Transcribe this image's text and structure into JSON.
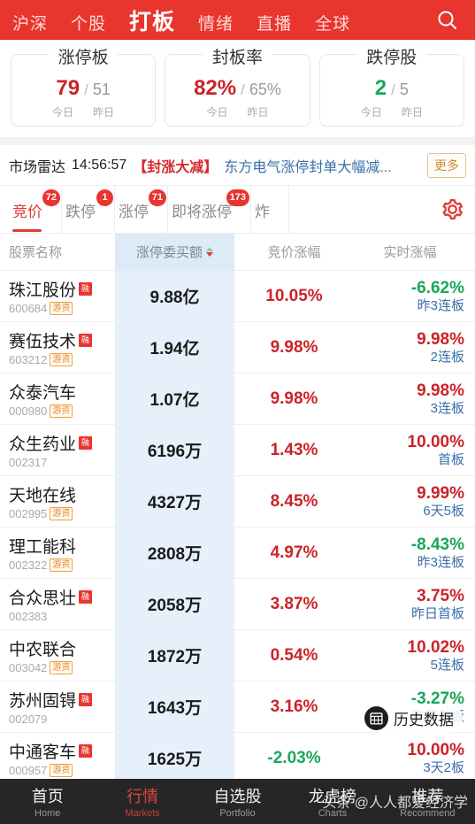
{
  "topnav": {
    "items": [
      {
        "label": "沪深",
        "active": false
      },
      {
        "label": "个股",
        "active": false
      },
      {
        "label": "打板",
        "active": true
      },
      {
        "label": "情绪",
        "active": false
      },
      {
        "label": "直播",
        "active": false
      },
      {
        "label": "全球",
        "active": false
      }
    ],
    "search_icon": "search-icon",
    "bg_color": "#e8352e"
  },
  "stats": [
    {
      "title": "涨停板",
      "today": "79",
      "sep": "/",
      "yesterday": "51",
      "today_label": "今日",
      "yesterday_label": "昨日",
      "trend": "up"
    },
    {
      "title": "封板率",
      "today": "82%",
      "sep": "/",
      "yesterday": "65%",
      "today_label": "今日",
      "yesterday_label": "昨日",
      "trend": "up"
    },
    {
      "title": "跌停股",
      "today": "2",
      "sep": "/",
      "yesterday": "5",
      "today_label": "今日",
      "yesterday_label": "昨日",
      "trend": "down"
    }
  ],
  "radar": {
    "label": "市场雷达",
    "time": "14:56:57",
    "tag": "【封涨大减】",
    "text": "东方电气涨停封单大幅减...",
    "more_label": "更多"
  },
  "tabs": [
    {
      "label": "竞价",
      "badge": "72",
      "active": true
    },
    {
      "label": "跌停",
      "badge": "1",
      "active": false
    },
    {
      "label": "涨停",
      "badge": "71",
      "active": false
    },
    {
      "label": "即将涨停",
      "badge": "173",
      "active": false
    },
    {
      "label": "炸",
      "badge": "",
      "active": false
    }
  ],
  "settings_icon": "gear-icon",
  "table": {
    "headers": {
      "name": "股票名称",
      "amount": "涨停委买额",
      "bid": "竞价涨幅",
      "realtime": "实时涨幅"
    },
    "sort": {
      "column": "涨停委买额",
      "direction": "desc"
    },
    "rows": [
      {
        "name": "珠江股份",
        "code": "600684",
        "rong": "融",
        "youzi": "游资",
        "amount": "9.88亿",
        "bid": "10.05%",
        "bid_dir": "up",
        "real": "-6.62%",
        "real_dir": "down",
        "note": "昨3连板"
      },
      {
        "name": "赛伍技术",
        "code": "603212",
        "rong": "融",
        "youzi": "游资",
        "amount": "1.94亿",
        "bid": "9.98%",
        "bid_dir": "up",
        "real": "9.98%",
        "real_dir": "up",
        "note": "2连板"
      },
      {
        "name": "众泰汽车",
        "code": "000980",
        "rong": "",
        "youzi": "游资",
        "amount": "1.07亿",
        "bid": "9.98%",
        "bid_dir": "up",
        "real": "9.98%",
        "real_dir": "up",
        "note": "3连板"
      },
      {
        "name": "众生药业",
        "code": "002317",
        "rong": "融",
        "youzi": "",
        "amount": "6196万",
        "bid": "1.43%",
        "bid_dir": "up",
        "real": "10.00%",
        "real_dir": "up",
        "note": "首板"
      },
      {
        "name": "天地在线",
        "code": "002995",
        "rong": "",
        "youzi": "游资",
        "amount": "4327万",
        "bid": "8.45%",
        "bid_dir": "up",
        "real": "9.99%",
        "real_dir": "up",
        "note": "6天5板"
      },
      {
        "name": "理工能科",
        "code": "002322",
        "rong": "",
        "youzi": "游资",
        "amount": "2808万",
        "bid": "4.97%",
        "bid_dir": "up",
        "real": "-8.43%",
        "real_dir": "down",
        "note": "昨3连板"
      },
      {
        "name": "合众思壮",
        "code": "002383",
        "rong": "融",
        "youzi": "",
        "amount": "2058万",
        "bid": "3.87%",
        "bid_dir": "up",
        "real": "3.75%",
        "real_dir": "up",
        "note": "昨日首板"
      },
      {
        "name": "中农联合",
        "code": "003042",
        "rong": "",
        "youzi": "游资",
        "amount": "1872万",
        "bid": "0.54%",
        "bid_dir": "up",
        "real": "10.02%",
        "real_dir": "up",
        "note": "5连板"
      },
      {
        "name": "苏州固锝",
        "code": "002079",
        "rong": "融",
        "youzi": "",
        "amount": "1643万",
        "bid": "3.16%",
        "bid_dir": "up",
        "real": "-3.27%",
        "real_dir": "down",
        "note": "昨日首板"
      },
      {
        "name": "中通客车",
        "code": "000957",
        "rong": "融",
        "youzi": "游资",
        "amount": "1625万",
        "bid": "-2.03%",
        "bid_dir": "down",
        "real": "10.00%",
        "real_dir": "up",
        "note": "3天2板"
      }
    ]
  },
  "history_pill": {
    "label": "历史数据",
    "icon": "calendar-icon"
  },
  "bottomnav": [
    {
      "cn": "首页",
      "en": "Home",
      "active": false
    },
    {
      "cn": "行情",
      "en": "Markets",
      "active": true
    },
    {
      "cn": "自选股",
      "en": "Portfolio",
      "active": false
    },
    {
      "cn": "龙虎榜",
      "en": "Charts",
      "active": false
    },
    {
      "cn": "推荐",
      "en": "Recommend",
      "active": false
    }
  ],
  "watermark": "头条 @人人都爱经济学"
}
